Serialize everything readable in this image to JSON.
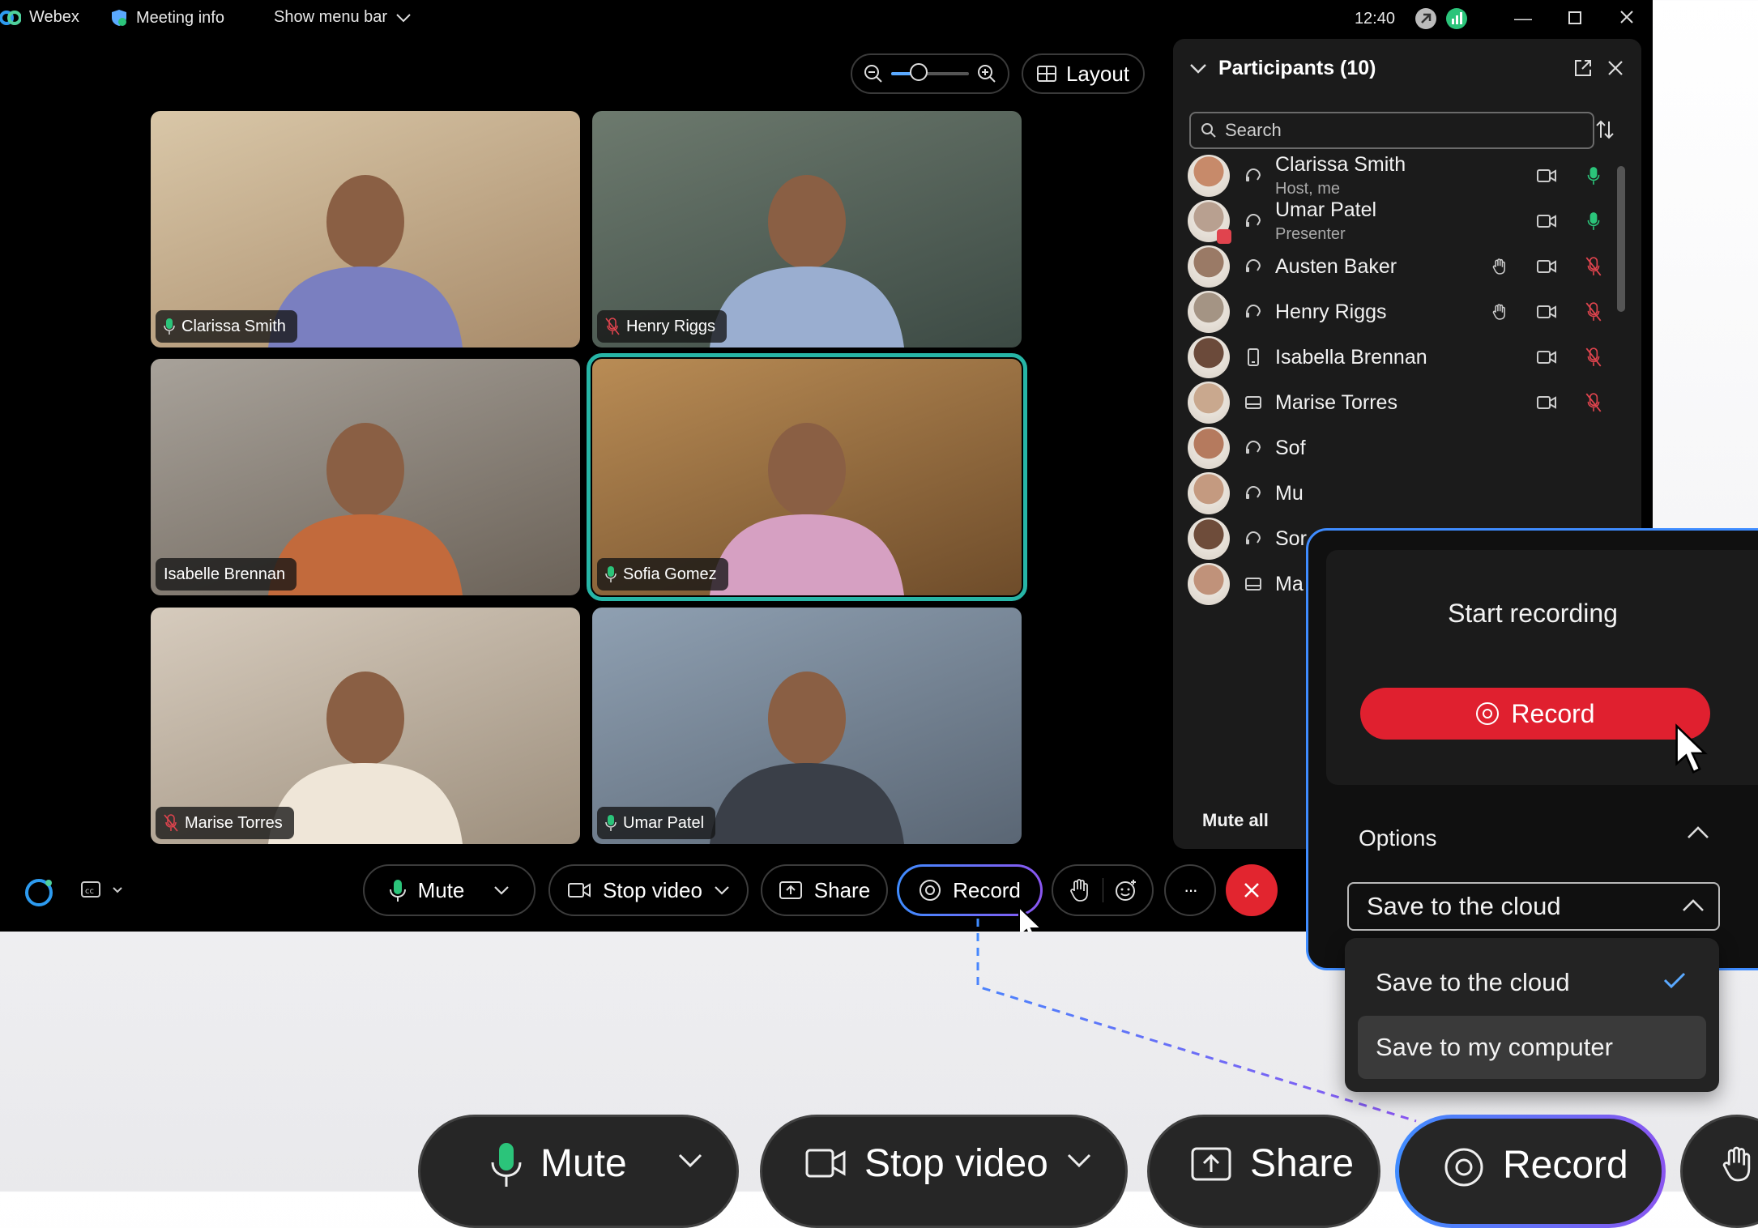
{
  "titlebar": {
    "app_name": "Webex",
    "meeting_info": "Meeting info",
    "show_menu_bar": "Show menu bar",
    "time": "12:40"
  },
  "stage": {
    "layout_label": "Layout",
    "zoom_level": 0.35
  },
  "tiles": [
    {
      "name": "Clarissa Smith",
      "mic": "on"
    },
    {
      "name": "Henry Riggs",
      "mic": "muted"
    },
    {
      "name": "Isabelle Brennan",
      "mic": "none"
    },
    {
      "name": "Sofia Gomez",
      "mic": "on",
      "active": true
    },
    {
      "name": "Marise Torres",
      "mic": "muted"
    },
    {
      "name": "Umar Patel",
      "mic": "on"
    }
  ],
  "participants": {
    "title": "Participants (10)",
    "search_placeholder": "Search",
    "mute_all": "Mute all",
    "list": [
      {
        "name": "Clarissa Smith",
        "role": "Host, me",
        "device": "headset",
        "hand": false,
        "mic": "on"
      },
      {
        "name": "Umar Patel",
        "role": "Presenter",
        "device": "headset",
        "hand": false,
        "mic": "on"
      },
      {
        "name": "Austen Baker",
        "role": "",
        "device": "headset",
        "hand": true,
        "mic": "muted"
      },
      {
        "name": "Henry Riggs",
        "role": "",
        "device": "headset",
        "hand": true,
        "mic": "muted"
      },
      {
        "name": "Isabella Brennan",
        "role": "",
        "device": "phone",
        "hand": false,
        "mic": "muted"
      },
      {
        "name": "Marise Torres",
        "role": "",
        "device": "room",
        "hand": false,
        "mic": "muted"
      },
      {
        "name": "Sof",
        "role": "",
        "device": "headset"
      },
      {
        "name": "Mu",
        "role": "",
        "device": "headset"
      },
      {
        "name": "Sor",
        "role": "",
        "device": "headset"
      },
      {
        "name": "Ma",
        "role": "",
        "device": "room"
      }
    ]
  },
  "controls": {
    "mute": "Mute",
    "stop_video": "Stop video",
    "share": "Share",
    "record": "Record",
    "more": "···"
  },
  "recording": {
    "title": "Start recording",
    "record_button": "Record",
    "options_label": "Options",
    "selected": "Save to the cloud",
    "options": [
      "Save to the cloud",
      "Save to my computer"
    ]
  },
  "colors": {
    "accent_blue": "#3f8cff",
    "accent_purple": "#8a56f0",
    "record_red": "#e0202f",
    "active_teal": "#27b5a6",
    "mic_green": "#2bc47a",
    "mic_muted": "#e0444e"
  }
}
